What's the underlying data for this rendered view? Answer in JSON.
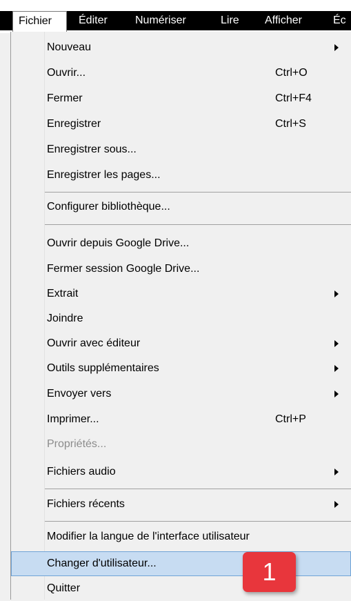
{
  "menubar": {
    "items": [
      "Fichier",
      "Éditer",
      "Numériser",
      "Lire",
      "Afficher",
      "Éc"
    ]
  },
  "menu": {
    "items": [
      {
        "label": "Nouveau",
        "shortcut": "",
        "submenu": true
      },
      {
        "label": "Ouvrir...",
        "shortcut": "Ctrl+O"
      },
      {
        "label": "Fermer",
        "shortcut": "Ctrl+F4"
      },
      {
        "label": "Enregistrer",
        "shortcut": "Ctrl+S"
      },
      {
        "label": "Enregistrer sous...",
        "shortcut": ""
      },
      {
        "label": "Enregistrer les pages...",
        "shortcut": ""
      },
      {
        "label": "Configurer bibliothèque...",
        "shortcut": ""
      },
      {
        "label": "Ouvrir depuis Google Drive...",
        "shortcut": ""
      },
      {
        "label": "Fermer session Google Drive...",
        "shortcut": ""
      },
      {
        "label": "Extrait",
        "shortcut": "",
        "submenu": true
      },
      {
        "label": "Joindre",
        "shortcut": ""
      },
      {
        "label": "Ouvrir avec éditeur",
        "shortcut": "",
        "submenu": true
      },
      {
        "label": "Outils supplémentaires",
        "shortcut": "",
        "submenu": true
      },
      {
        "label": "Envoyer vers",
        "shortcut": "",
        "submenu": true
      },
      {
        "label": "Imprimer...",
        "shortcut": "Ctrl+P"
      },
      {
        "label": "Propriétés...",
        "shortcut": "",
        "disabled": true
      },
      {
        "label": "Fichiers audio",
        "shortcut": "",
        "submenu": true
      },
      {
        "label": "Fichiers récents",
        "shortcut": "",
        "submenu": true
      },
      {
        "label": "Modifier  la langue de l'interface utilisateur",
        "shortcut": ""
      },
      {
        "label": "Changer d'utilisateur...",
        "shortcut": "",
        "highlighted": true
      },
      {
        "label": "Quitter",
        "shortcut": ""
      }
    ]
  },
  "callout": {
    "number": "1"
  },
  "colors": {
    "highlight": "#c7dcf2",
    "badge": "#e8363c",
    "menubar": "#000000"
  }
}
